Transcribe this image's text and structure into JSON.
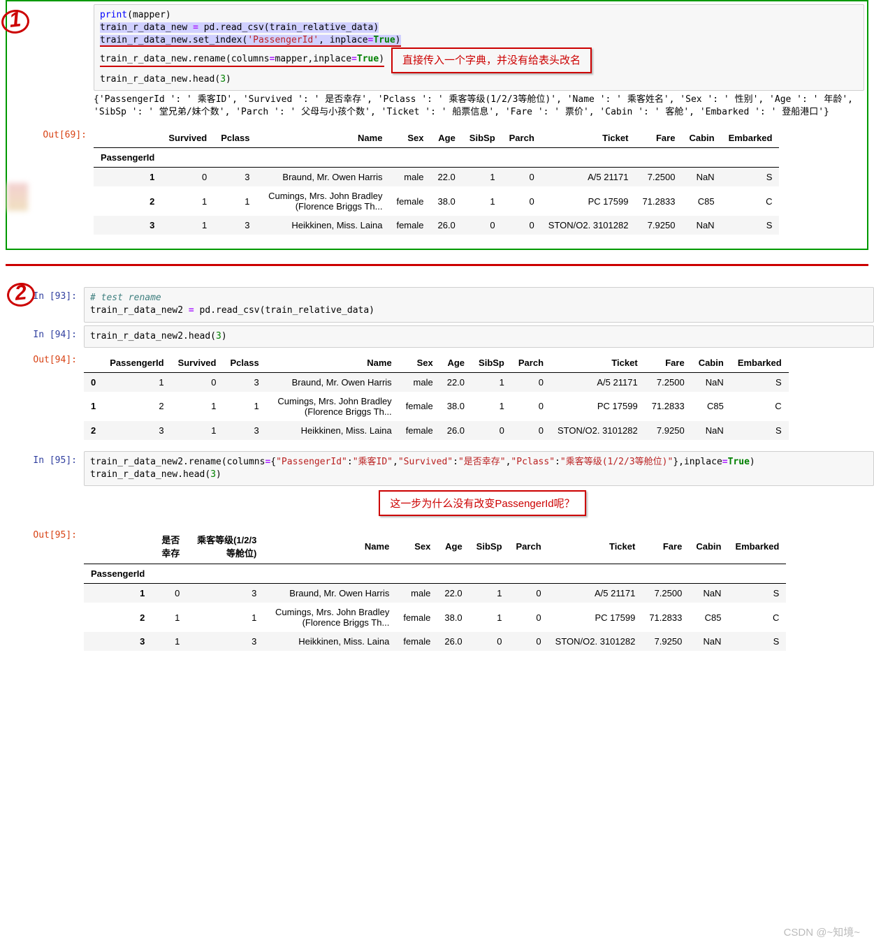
{
  "watermark": "CSDN @~知境~",
  "annotations": {
    "circle1": "1",
    "circle2": "2",
    "red_note_1": "直接传入一个字典，并没有给表头改名",
    "red_note_2": "这一步为什么没有改变PassengerId呢？"
  },
  "cell_top": {
    "out_prompt": "Out[69]:",
    "code": {
      "l1_fn": "print",
      "l1_rest": "(mapper)",
      "l2_a": "train_r_data_new ",
      "l2_op": "=",
      "l2_b": " pd.read_csv(train_relative_data)",
      "l3_a": "train_r_data_new.set_index(",
      "l3_str": "'PassengerId'",
      "l3_b": ", inplace",
      "l3_op": "=",
      "l3_bool": "True",
      "l3_c": ")",
      "l4_a": "train_r_data_new.rename(columns",
      "l4_op1": "=",
      "l4_b": "mapper,inplace",
      "l4_op2": "=",
      "l4_bool": "True",
      "l4_c": ")",
      "l5_a": "train_r_data_new.head(",
      "l5_num": "3",
      "l5_b": ")"
    },
    "printed": "{'PassengerId ': ' 乘客ID', 'Survived ': ' 是否幸存', 'Pclass ': ' 乘客等级(1/2/3等舱位)', 'Name ': ' 乘客姓名', 'Sex ': ' 性别', 'Age ': ' 年龄', 'SibSp ': ' 堂兄弟/妹个数', 'Parch ': ' 父母与小孩个数', 'Ticket ': ' 船票信息', 'Fare ': ' 票价', 'Cabin ': ' 客舱', 'Embarked ': ' 登船港口'}",
    "table": {
      "index_name": "PassengerId",
      "columns": [
        "Survived",
        "Pclass",
        "Name",
        "Sex",
        "Age",
        "SibSp",
        "Parch",
        "Ticket",
        "Fare",
        "Cabin",
        "Embarked"
      ],
      "rows": [
        {
          "idx": "1",
          "vals": [
            "0",
            "3",
            "Braund, Mr. Owen Harris",
            "male",
            "22.0",
            "1",
            "0",
            "A/5 21171",
            "7.2500",
            "NaN",
            "S"
          ]
        },
        {
          "idx": "2",
          "vals": [
            "1",
            "1",
            "Cumings, Mrs. John Bradley (Florence Briggs Th...",
            "female",
            "38.0",
            "1",
            "0",
            "PC 17599",
            "71.2833",
            "C85",
            "C"
          ]
        },
        {
          "idx": "3",
          "vals": [
            "1",
            "3",
            "Heikkinen, Miss. Laina",
            "female",
            "26.0",
            "0",
            "0",
            "STON/O2. 3101282",
            "7.9250",
            "NaN",
            "S"
          ]
        }
      ]
    }
  },
  "cell93": {
    "in_prompt": "In [93]:",
    "code": {
      "l1": "# test rename",
      "l2_a": "train_r_data_new2 ",
      "l2_op": "=",
      "l2_b": " pd.read_csv(train_relative_data)"
    }
  },
  "cell94": {
    "in_prompt": "In [94]:",
    "out_prompt": "Out[94]:",
    "code": {
      "l1_a": "train_r_data_new2.head(",
      "l1_num": "3",
      "l1_b": ")"
    },
    "table": {
      "columns": [
        "PassengerId",
        "Survived",
        "Pclass",
        "Name",
        "Sex",
        "Age",
        "SibSp",
        "Parch",
        "Ticket",
        "Fare",
        "Cabin",
        "Embarked"
      ],
      "rows": [
        {
          "idx": "0",
          "vals": [
            "1",
            "0",
            "3",
            "Braund, Mr. Owen Harris",
            "male",
            "22.0",
            "1",
            "0",
            "A/5 21171",
            "7.2500",
            "NaN",
            "S"
          ]
        },
        {
          "idx": "1",
          "vals": [
            "2",
            "1",
            "1",
            "Cumings, Mrs. John Bradley (Florence Briggs Th...",
            "female",
            "38.0",
            "1",
            "0",
            "PC 17599",
            "71.2833",
            "C85",
            "C"
          ]
        },
        {
          "idx": "2",
          "vals": [
            "3",
            "1",
            "3",
            "Heikkinen, Miss. Laina",
            "female",
            "26.0",
            "0",
            "0",
            "STON/O2. 3101282",
            "7.9250",
            "NaN",
            "S"
          ]
        }
      ]
    }
  },
  "cell95": {
    "in_prompt": "In [95]:",
    "out_prompt": "Out[95]:",
    "code": {
      "l1_a": "train_r_data_new2.rename(columns",
      "l1_op1": "=",
      "l1_b": "{",
      "l1_s1": "\"PassengerId\"",
      "l1_c": ":",
      "l1_s2": "\"乘客ID\"",
      "l1_d": ",",
      "l1_s3": "\"Survived\"",
      "l1_e": ":",
      "l1_s4": "\"是否幸存\"",
      "l1_f": ",",
      "l1_s5": "\"Pclass\"",
      "l1_g": ":",
      "l1_s6": "\"乘客等级(1/2/3等舱位)\"",
      "l1_h": "},inplace",
      "l1_op2": "=",
      "l1_bool": "True",
      "l1_i": ")",
      "l2_a": "train_r_data_new.head(",
      "l2_num": "3",
      "l2_b": ")"
    },
    "table": {
      "index_name": "PassengerId",
      "columns": [
        "是否幸存",
        "乘客等级(1/2/3等舱位)",
        "Name",
        "Sex",
        "Age",
        "SibSp",
        "Parch",
        "Ticket",
        "Fare",
        "Cabin",
        "Embarked"
      ],
      "rows": [
        {
          "idx": "1",
          "vals": [
            "0",
            "3",
            "Braund, Mr. Owen Harris",
            "male",
            "22.0",
            "1",
            "0",
            "A/5 21171",
            "7.2500",
            "NaN",
            "S"
          ]
        },
        {
          "idx": "2",
          "vals": [
            "1",
            "1",
            "Cumings, Mrs. John Bradley (Florence Briggs Th...",
            "female",
            "38.0",
            "1",
            "0",
            "PC 17599",
            "71.2833",
            "C85",
            "C"
          ]
        },
        {
          "idx": "3",
          "vals": [
            "1",
            "3",
            "Heikkinen, Miss. Laina",
            "female",
            "26.0",
            "0",
            "0",
            "STON/O2. 3101282",
            "7.9250",
            "NaN",
            "S"
          ]
        }
      ]
    }
  }
}
